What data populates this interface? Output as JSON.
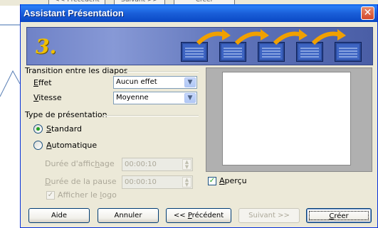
{
  "background": {
    "buttons": [
      "<< Précédent",
      "Suivant >>",
      "Créer"
    ]
  },
  "window": {
    "title": "Assistant Présentation",
    "close_glyph": "✕"
  },
  "banner": {
    "step": "3.",
    "icons": [
      "slide-icon",
      "curved-arrow-icon"
    ]
  },
  "transition": {
    "heading": "Transition entre les diapos",
    "effect": {
      "label_accel": "E",
      "label_rest": "ffet",
      "value": "Aucun effet"
    },
    "speed": {
      "label_accel": "V",
      "label_rest": "itesse",
      "value": "Moyenne"
    }
  },
  "presentation_type": {
    "heading": "Type de présentation",
    "standard": {
      "label_accel": "S",
      "label_rest": "tandard",
      "checked": true
    },
    "automatic": {
      "label_accel": "A",
      "label_rest": "utomatique",
      "checked": false
    },
    "display_duration": {
      "label_pre": "Durée d'affic",
      "label_accel": "h",
      "label_post": "age",
      "value": "00:00:10"
    },
    "pause_duration": {
      "label_accel": "D",
      "label_rest": "urée de la pause",
      "value": "00:00:10"
    },
    "show_logo": {
      "label_pre": "Afficher le ",
      "label_accel": "l",
      "label_post": "ogo",
      "checked": true
    }
  },
  "preview": {
    "label_accel": "A",
    "label_rest": "perçu",
    "checked": true
  },
  "buttons": {
    "help": "Aide",
    "cancel": "Annuler",
    "previous_pre": "<< ",
    "previous_accel": "P",
    "previous_post": "récédent",
    "next": "Suivant >>",
    "create_accel": "C",
    "create_rest": "réer"
  },
  "colors": {
    "titlebar": "#0a5fe6",
    "dialog_bg": "#ece9d8",
    "banner": "#5a6fb5",
    "step_number": "#f0c000",
    "arrow": "#f0a000"
  }
}
